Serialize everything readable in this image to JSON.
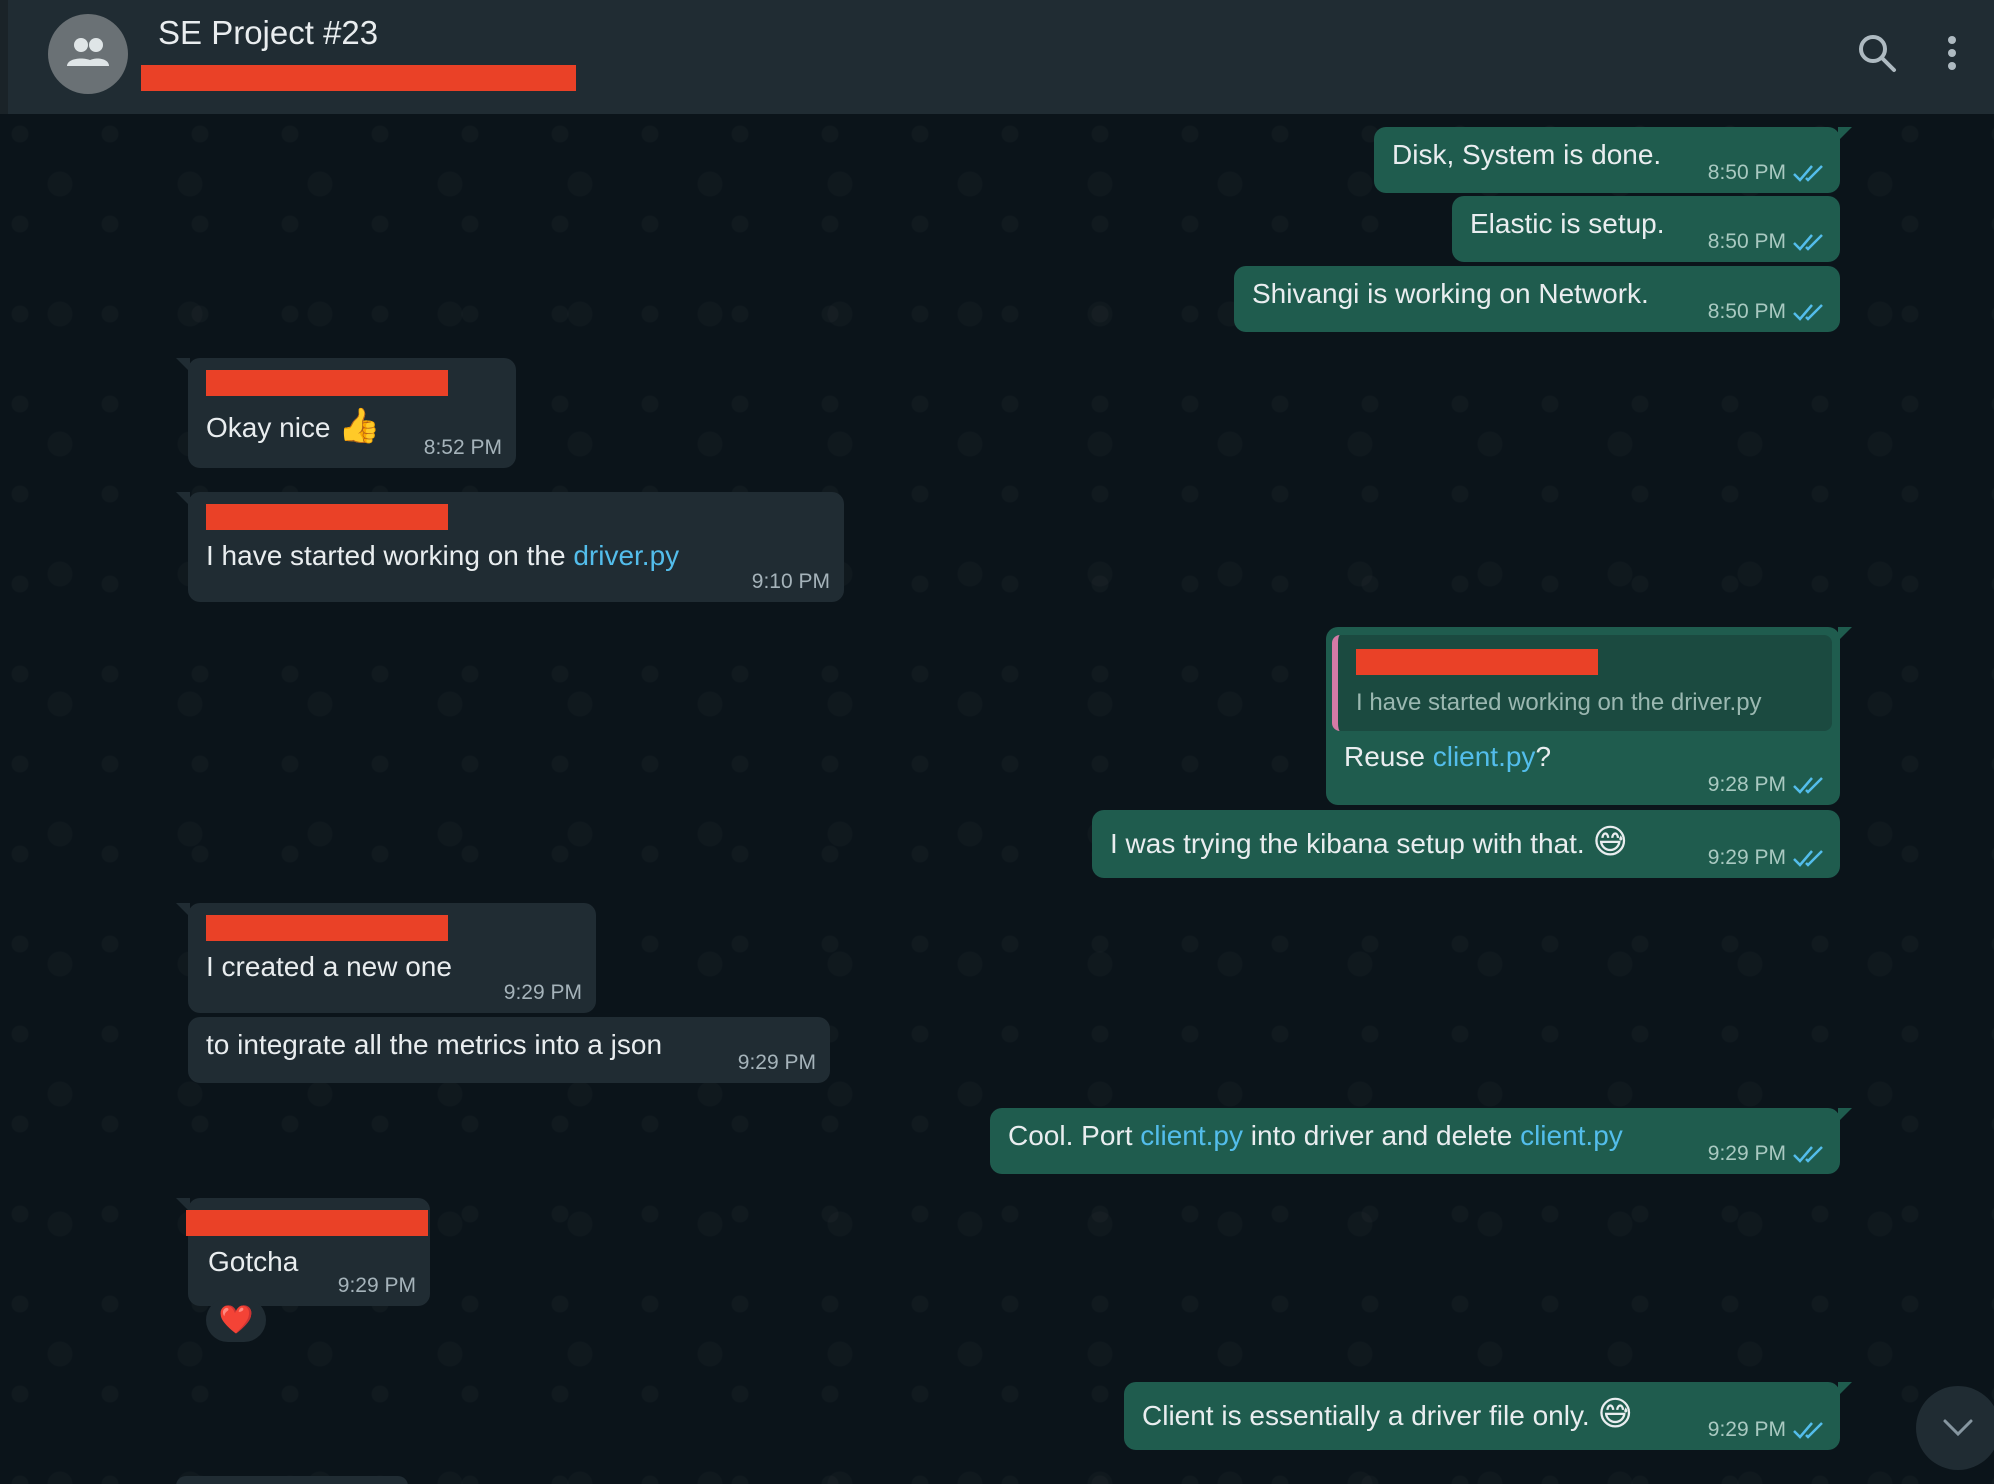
{
  "header": {
    "title": "SE Project #23",
    "icons": [
      "group-avatar-icon",
      "search-icon",
      "more-options-icon"
    ]
  },
  "messages": [
    {
      "dir": "out",
      "text": "Disk, System is done.",
      "time": "8:50 PM"
    },
    {
      "dir": "out",
      "text": "Elastic is setup.",
      "time": "8:50 PM"
    },
    {
      "dir": "out",
      "text": "Shivangi is working on Network.",
      "time": "8:50 PM"
    },
    {
      "dir": "in",
      "text": "Okay nice",
      "emoji": "👍",
      "time": "8:52 PM"
    },
    {
      "dir": "in",
      "text_before": "I have started working on the ",
      "link": "driver.py",
      "time": "9:10 PM"
    },
    {
      "dir": "out",
      "quote": "I have started working on the driver.py",
      "text_before": "Reuse ",
      "link": "client.py",
      "text_after": "?",
      "time": "9:28 PM"
    },
    {
      "dir": "out",
      "text": "I was trying the kibana setup with that.",
      "emoji": "😅",
      "time": "9:29 PM"
    },
    {
      "dir": "in",
      "text": "I created a new one",
      "time": "9:29 PM"
    },
    {
      "dir": "in",
      "text": "to integrate all the metrics into a json",
      "time": "9:29 PM"
    },
    {
      "dir": "out",
      "text_before": "Cool. Port ",
      "link": "client.py",
      "text_middle": " into driver and delete ",
      "link2": "client.py",
      "time": "9:29 PM"
    },
    {
      "dir": "in",
      "text": "Gotcha",
      "time": "9:29 PM",
      "reaction": "❤️"
    },
    {
      "dir": "out",
      "text": "Client is essentially a driver file only.",
      "emoji": "😅",
      "time": "9:29 PM"
    }
  ],
  "colors": {
    "outgoing_bubble": "#1f5c4e",
    "incoming_bubble": "#202c33",
    "link": "#53bdeb",
    "redaction": "#ea4127",
    "background": "#0b141a"
  }
}
